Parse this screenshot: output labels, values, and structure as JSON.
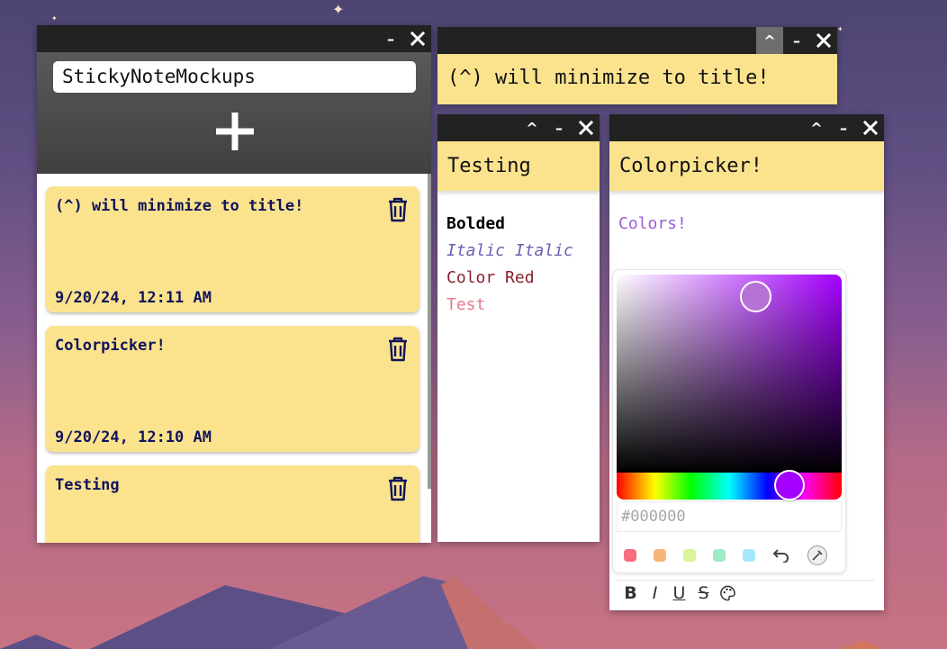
{
  "main": {
    "search_value": "StickyNoteMockups",
    "notes": [
      {
        "title": "(^) will minimize to title!",
        "date": "9/20/24, 12:11 AM"
      },
      {
        "title": "Colorpicker!",
        "date": "9/20/24, 12:10 AM"
      },
      {
        "title": "Testing",
        "date": ""
      }
    ]
  },
  "titlebar": {
    "minimize_glyph": "–",
    "collapse_glyph": "^"
  },
  "windows": {
    "minimized_note": {
      "title": "(^) will minimize to title!"
    },
    "testing_note": {
      "title": "Testing",
      "lines": {
        "bold": "Bolded",
        "italic": "Italic Italic",
        "red": "Color Red",
        "pink": "Test"
      }
    },
    "color_note": {
      "title": "Colorpicker!",
      "body": "Colors!",
      "picker": {
        "hex_placeholder": "#000000",
        "current_hue": "#a400ff",
        "swatches": [
          "#f76c7e",
          "#f8b47a",
          "#d8f59a",
          "#a0ebc6",
          "#a6e8fb"
        ]
      },
      "toolbar": {
        "bold": "B",
        "italic": "I",
        "underline": "U",
        "strike": "S"
      }
    }
  },
  "colors": {
    "note_yellow": "#fbe38e",
    "titlebar": "#222222",
    "note_text": "#11145a",
    "italic_text": "#6a5fb0",
    "red_text": "#8b1f2d",
    "pink_text": "#e57b8c",
    "purple_text": "#9b5ed8"
  }
}
